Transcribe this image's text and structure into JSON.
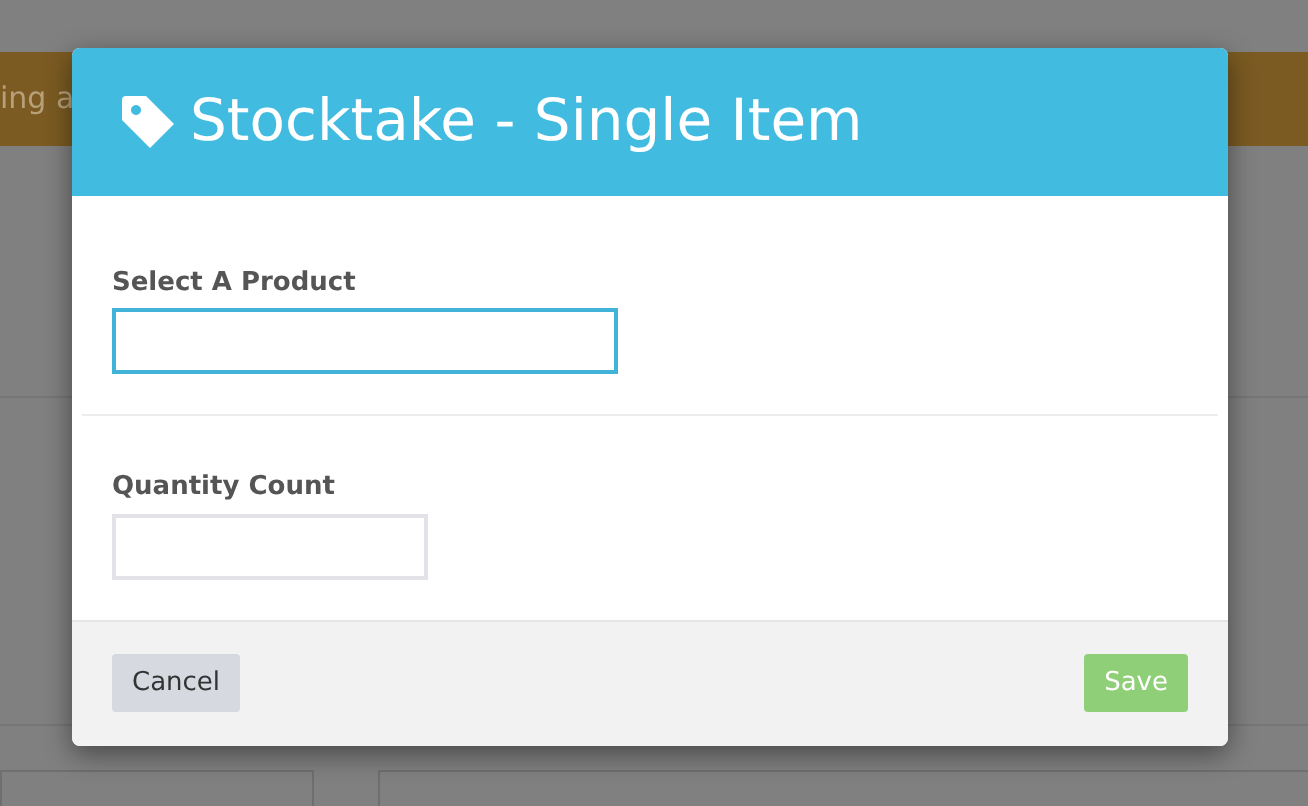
{
  "background": {
    "banner_text": "ing a"
  },
  "dialog": {
    "title": "Stocktake - Single Item",
    "fields": [
      {
        "label": "Select A Product",
        "focused": true,
        "kind": "select"
      },
      {
        "label": "Quantity Count",
        "focused": false,
        "kind": "number"
      }
    ],
    "buttons": [
      {
        "label": "Cancel",
        "kind": "secondary",
        "disabled": false
      },
      {
        "label": "Save",
        "kind": "primary",
        "disabled": true
      }
    ]
  }
}
